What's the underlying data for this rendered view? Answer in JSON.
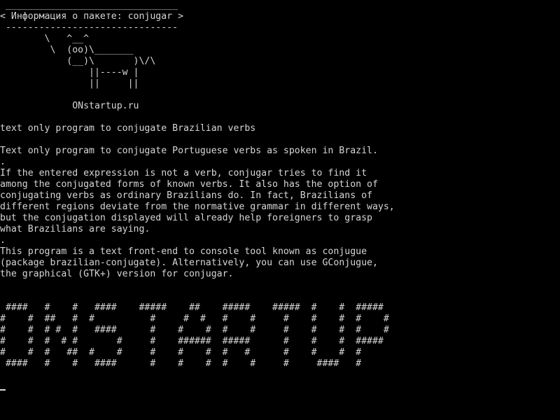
{
  "terminal": {
    "cowsay": {
      "border_top": " _______________________________",
      "bubble": "< Информация о пакете: conjugar >",
      "border_bottom": " -------------------------------",
      "cow": [
        "        \\   ^__^",
        "         \\  (oo)\\_______",
        "            (__)\\       )\\/\\",
        "                ||----w |",
        "                ||     ||"
      ],
      "site": "             ONstartup.ru"
    },
    "summary": "text only program to conjugate Brazilian verbs",
    "description": [
      "Text only program to conjugate Portuguese verbs as spoken in Brazil.",
      ".",
      "If the entered expression is not a verb, conjugar tries to find it",
      "among the conjugated forms of known verbs. It also has the option of",
      "conjugating verbs as ordinary Brazilians do. In fact, Brazilians of",
      "different regions deviate from the normative grammar in different ways,",
      "but the conjugation displayed will already help foreigners to grasp",
      "what Brazilians are saying.",
      ".",
      "This program is a text front-end to console tool known as conjugue",
      "(package brazilian-conjugate). Alternatively, you can use GConjugue,",
      "the graphical (GTK+) version for conjugar."
    ],
    "banner": [
      " ####   #    #   ####    #####    ##    #####    #####  #    #  #####",
      "#    #  ##   #  #          #     #  #   #    #     #    #    #  #    #",
      "#    #  # #  #   ####      #    #    #  #    #     #    #    #  #    #",
      "#    #  #  # #       #     #    ######  #####      #    #    #  #####",
      "#    #  #   ##  #    #     #    #    #  #   #      #    #    #  #",
      " ####   #    #   ####      #    #    #  #    #     #     ####   #"
    ],
    "colors": {
      "background": "#000000",
      "text": "#d6d6d6"
    }
  }
}
